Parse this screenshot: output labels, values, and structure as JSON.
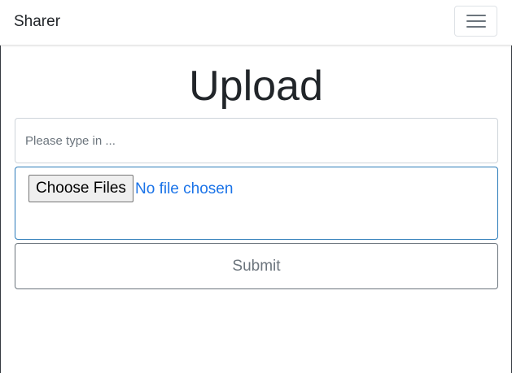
{
  "navbar": {
    "brand": "Sharer",
    "toggle_icon": "hamburger-menu-icon"
  },
  "main": {
    "title": "Upload",
    "text_input": {
      "placeholder": "Please type in ...",
      "value": ""
    },
    "file_input": {
      "button_label": "Choose Files",
      "status": "No file chosen"
    },
    "submit_label": "Submit"
  },
  "colors": {
    "accent_border": "#2b7bb9",
    "file_status_text": "#1a73e8",
    "submit_text": "#6c757d"
  }
}
